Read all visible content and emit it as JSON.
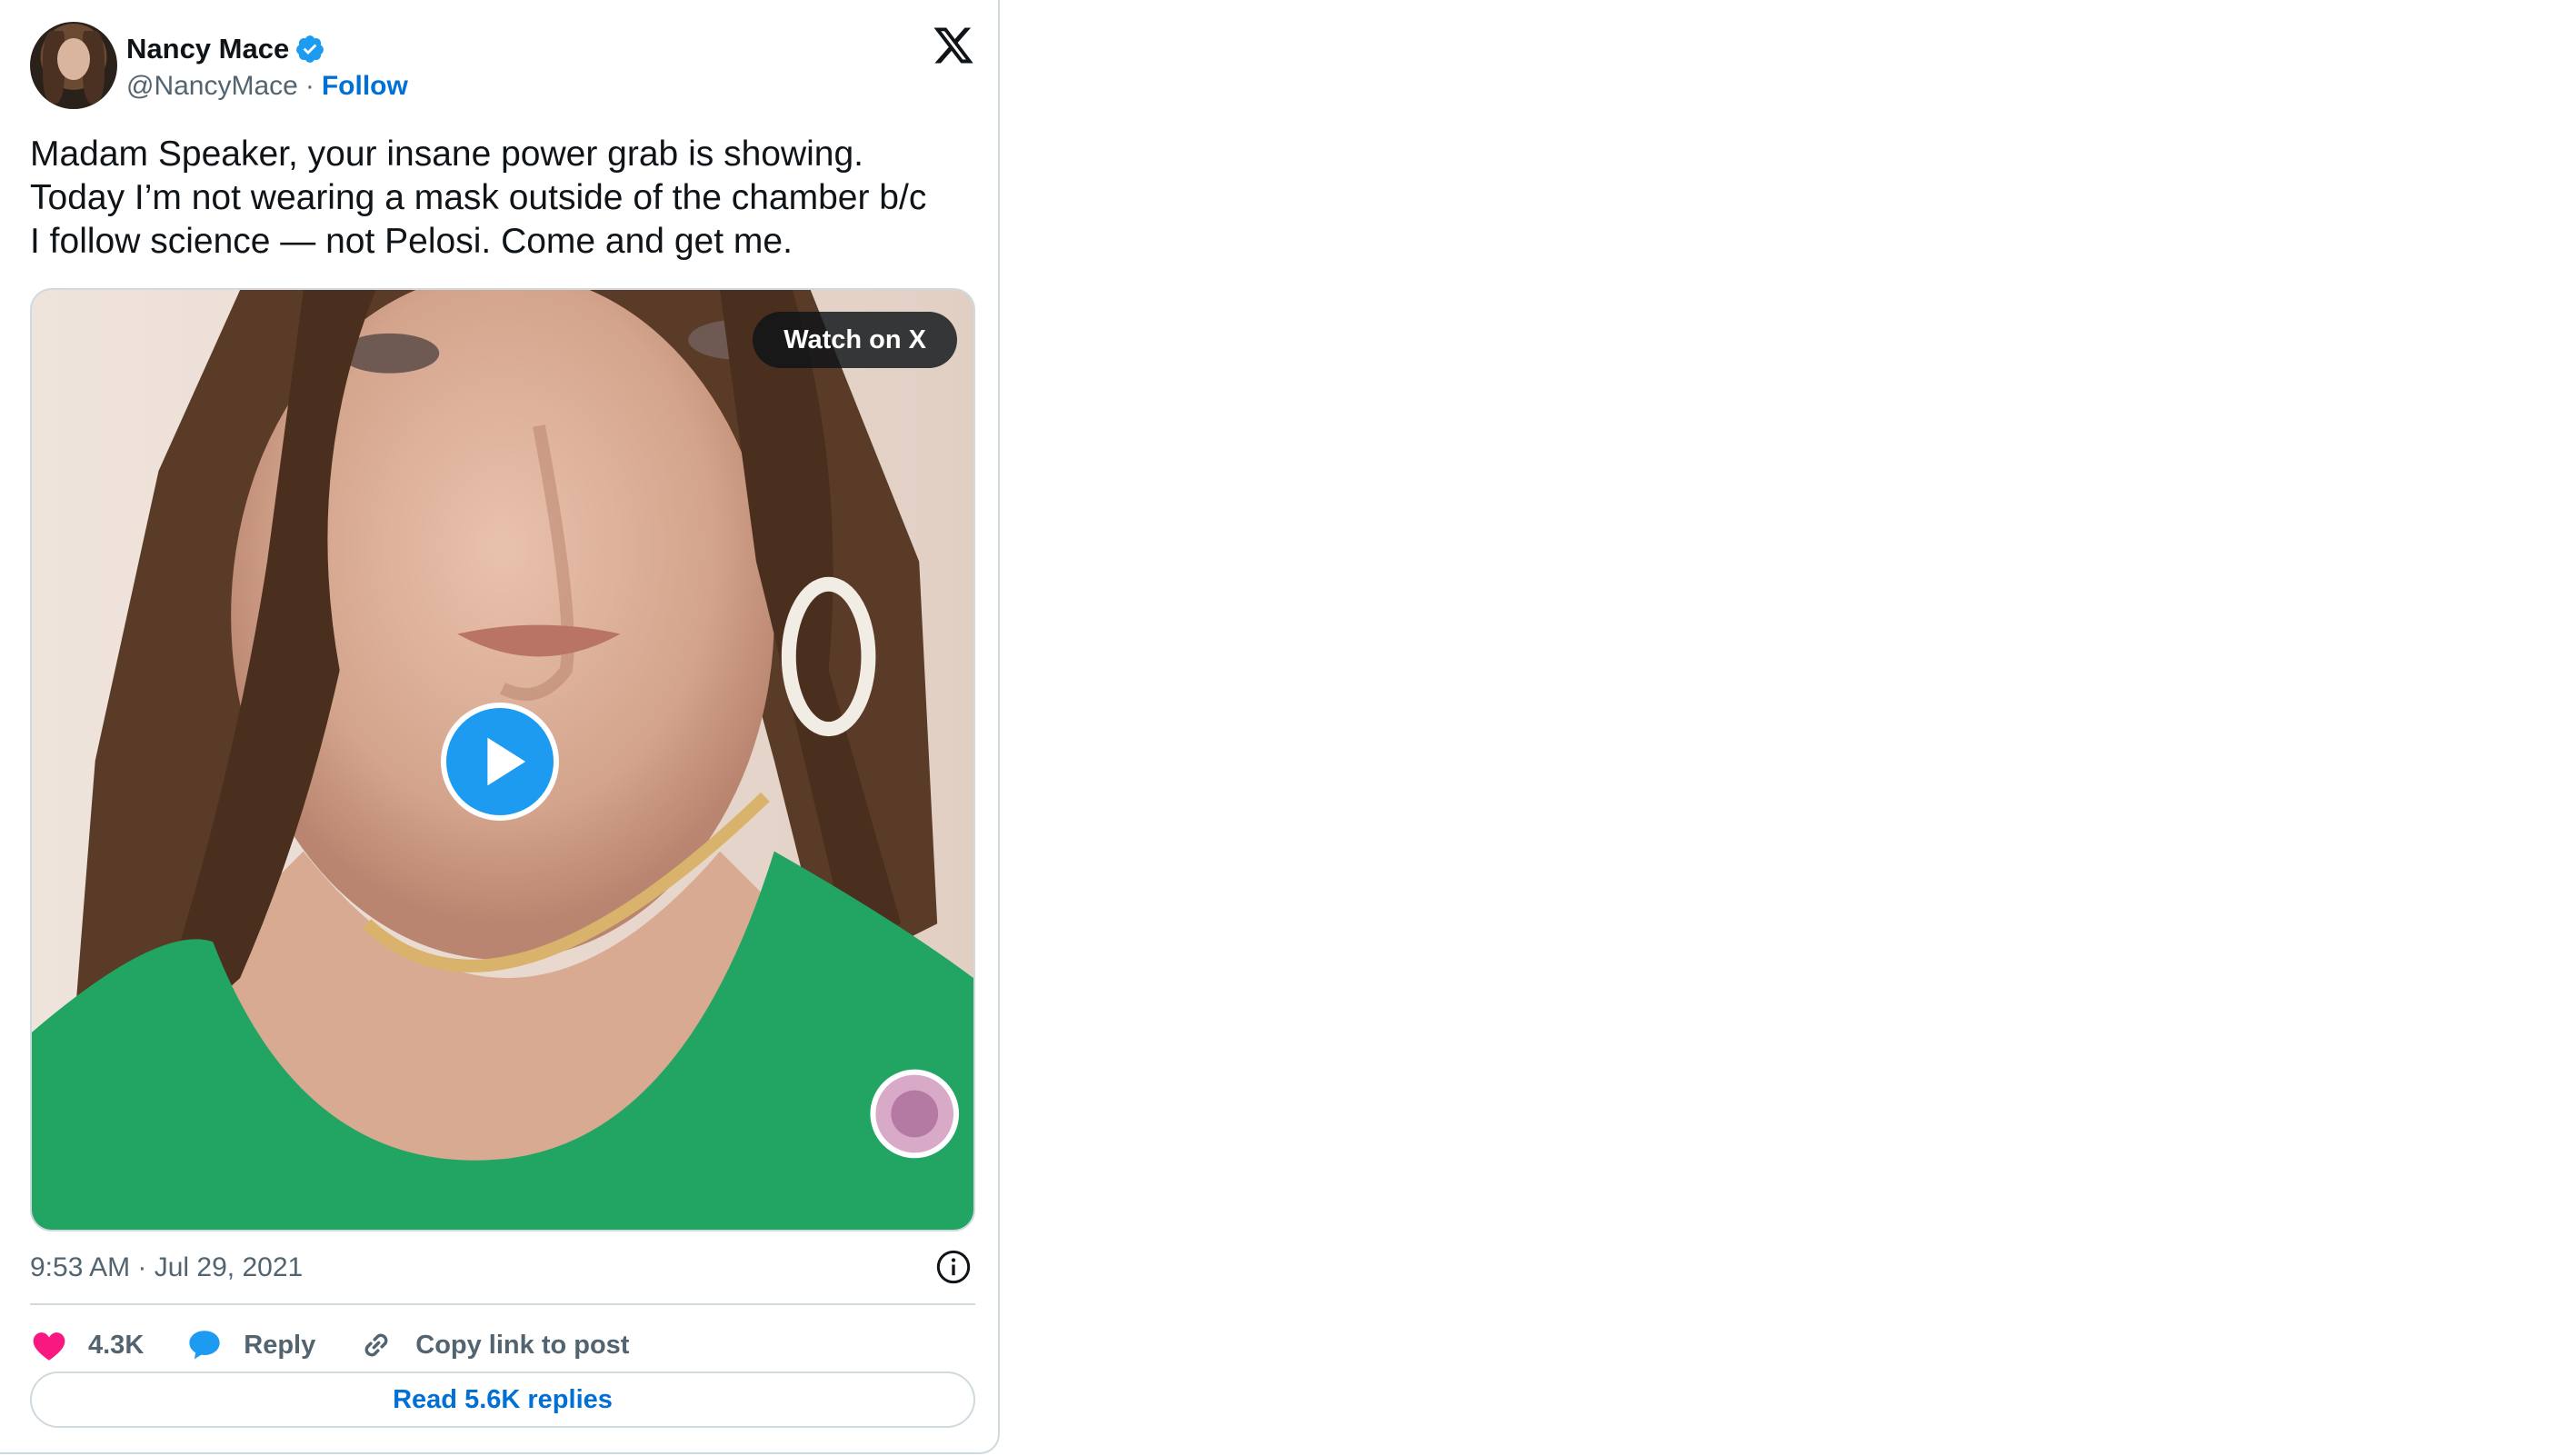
{
  "author": {
    "display_name": "Nancy Mace",
    "handle": "@NancyMace",
    "separator": "·",
    "follow_label": "Follow",
    "verified": true
  },
  "platform_icon": "x-logo-icon",
  "tweet": {
    "text": "Madam Speaker, your insane power grab is showing.\nToday I’m not wearing a mask outside of the chamber b/c\nI follow science — not Pelosi. Come and get me."
  },
  "media": {
    "watch_label": "Watch on X",
    "play_icon": "play-icon"
  },
  "meta": {
    "timestamp": "9:53 AM · Jul 29, 2021",
    "info_icon": "info-icon"
  },
  "actions": {
    "like_count": "4.3K",
    "reply_label": "Reply",
    "copy_label": "Copy link to post"
  },
  "read_replies_label": "Read 5.6K replies",
  "colors": {
    "link_blue": "#006fd6",
    "play_blue": "#1d9bf0",
    "like_pink": "#f91880",
    "text_primary": "#0f1419",
    "text_secondary": "#536471",
    "border": "#cfd9de"
  }
}
